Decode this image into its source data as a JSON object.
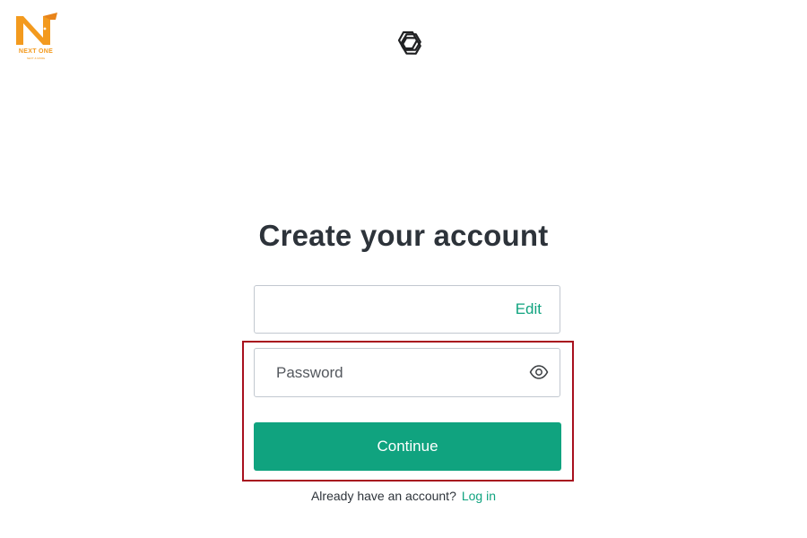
{
  "watermark": {
    "name": "NEXT ONE",
    "tagline": "NEXT & MORE",
    "color": "#f39a1e"
  },
  "header": {
    "logo_icon": "openai-logo-icon"
  },
  "form": {
    "title": "Create your account",
    "email": {
      "value": "",
      "edit_label": "Edit"
    },
    "password": {
      "placeholder": "Password",
      "value": "",
      "toggle_icon": "eye-icon"
    },
    "continue_label": "Continue",
    "highlight_color": "#a8101e"
  },
  "footer": {
    "prompt": "Already have an account?",
    "login_label": "Log in"
  },
  "colors": {
    "accent": "#10a37f",
    "text": "#2d333a",
    "border": "#c2c8d0"
  }
}
